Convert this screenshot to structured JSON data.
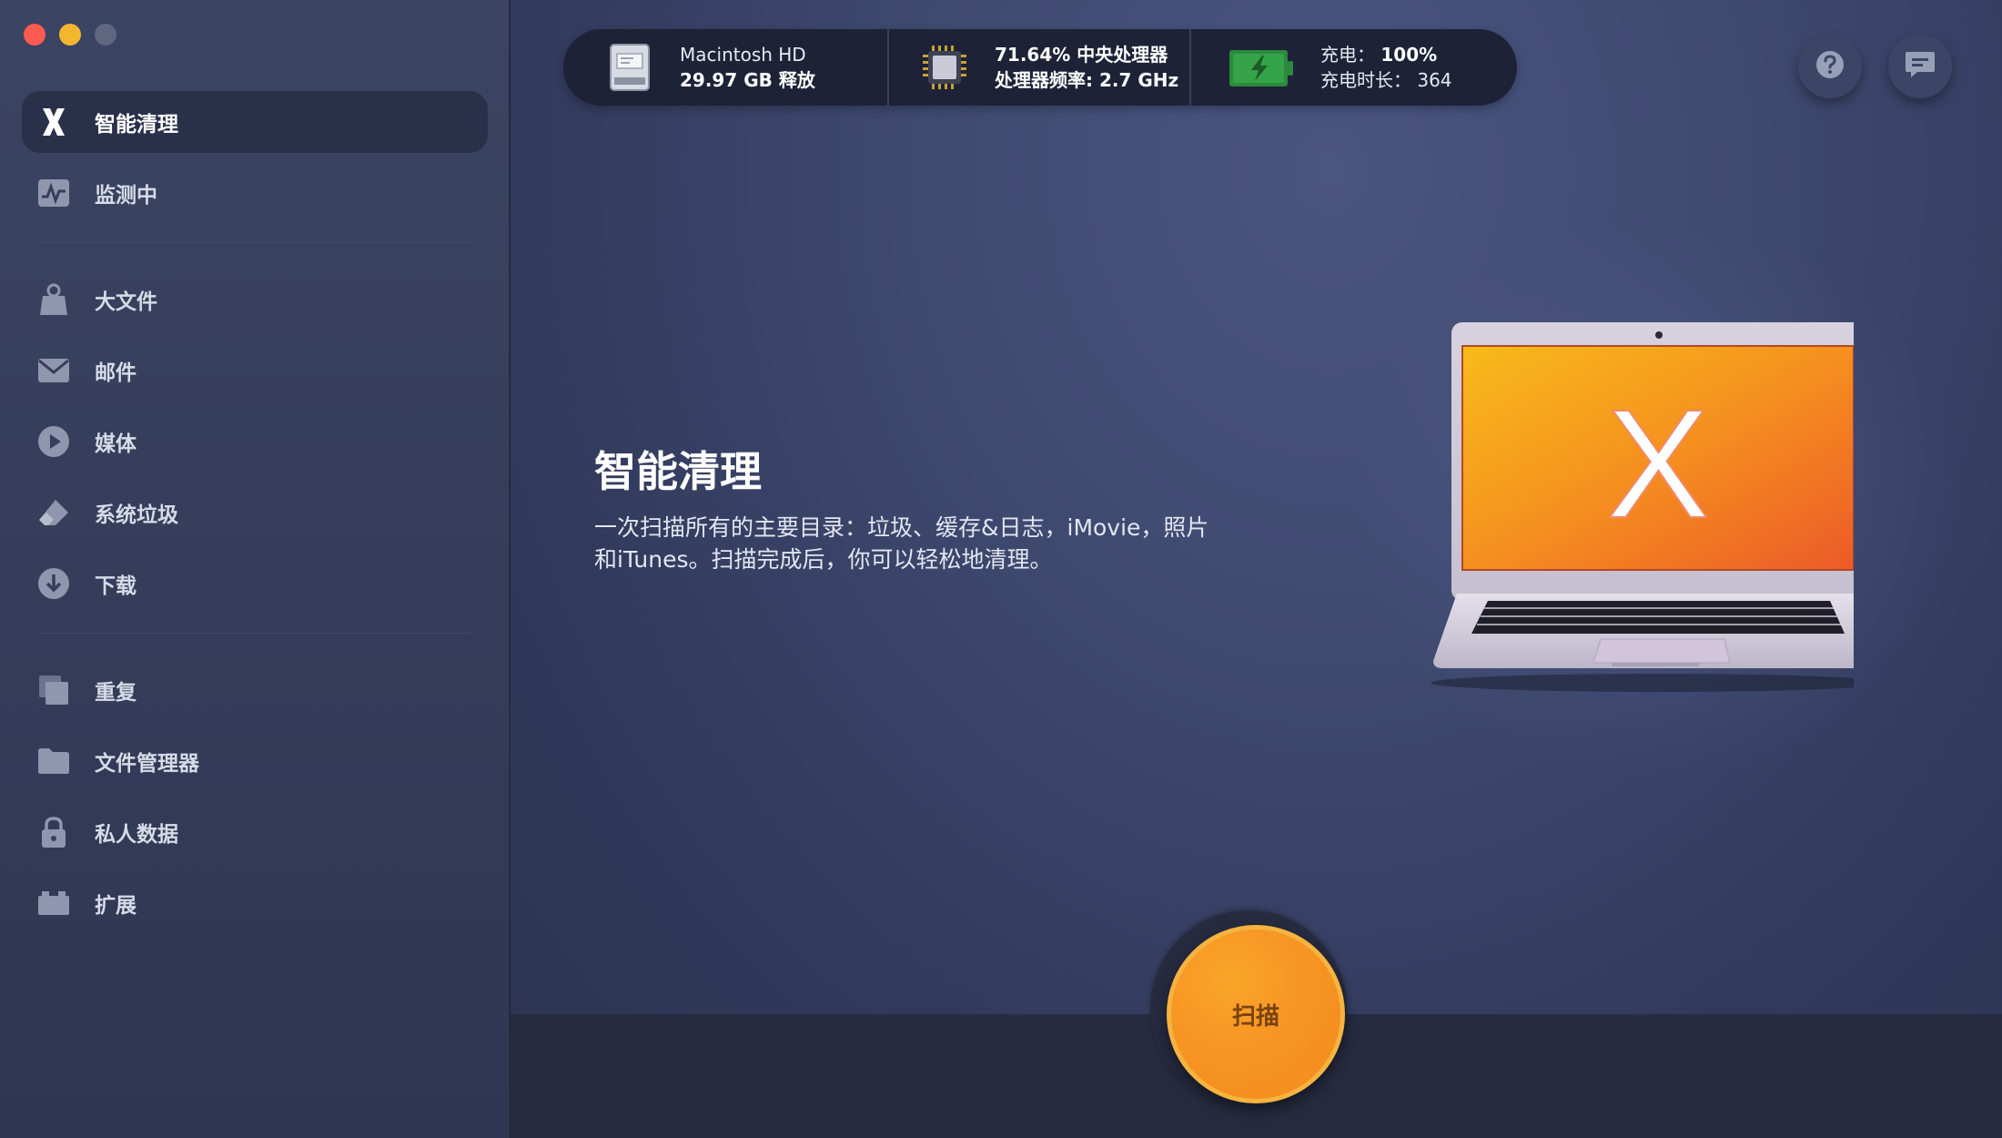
{
  "sidebar": {
    "items": [
      {
        "label": "智能清理",
        "icon": "x-logo-icon"
      },
      {
        "label": "监测中",
        "icon": "monitor-icon"
      },
      {
        "label": "大文件",
        "icon": "weight-icon"
      },
      {
        "label": "邮件",
        "icon": "mail-icon"
      },
      {
        "label": "媒体",
        "icon": "play-icon"
      },
      {
        "label": "系统垃圾",
        "icon": "eraser-icon"
      },
      {
        "label": "下载",
        "icon": "download-icon"
      },
      {
        "label": "重复",
        "icon": "duplicate-icon"
      },
      {
        "label": "文件管理器",
        "icon": "folder-icon"
      },
      {
        "label": "私人数据",
        "icon": "lock-icon"
      },
      {
        "label": "扩展",
        "icon": "extension-icon"
      }
    ]
  },
  "status": {
    "disk_name": "Macintosh HD",
    "disk_free": "29.97 GB 释放",
    "cpu_load": "71.64% 中央处理器",
    "cpu_freq": "处理器频率: 2.7 GHz",
    "battery_label": "充电：",
    "battery_value": "100%",
    "cycles_label": "充电时长：",
    "cycles_value": "364"
  },
  "main": {
    "title": "智能清理",
    "description": "一次扫描所有的主要目录：垃圾、缓存&日志，iMovie，照片和iTunes。扫描完成后，你可以轻松地清理。",
    "laptop_logo": "X",
    "scan_button": "扫描"
  },
  "colors": {
    "accent_orange": "#f79523",
    "sidebar_bg": "#363e5c",
    "main_bg": "#3f4a70",
    "active_item_bg": "#2a304a"
  }
}
